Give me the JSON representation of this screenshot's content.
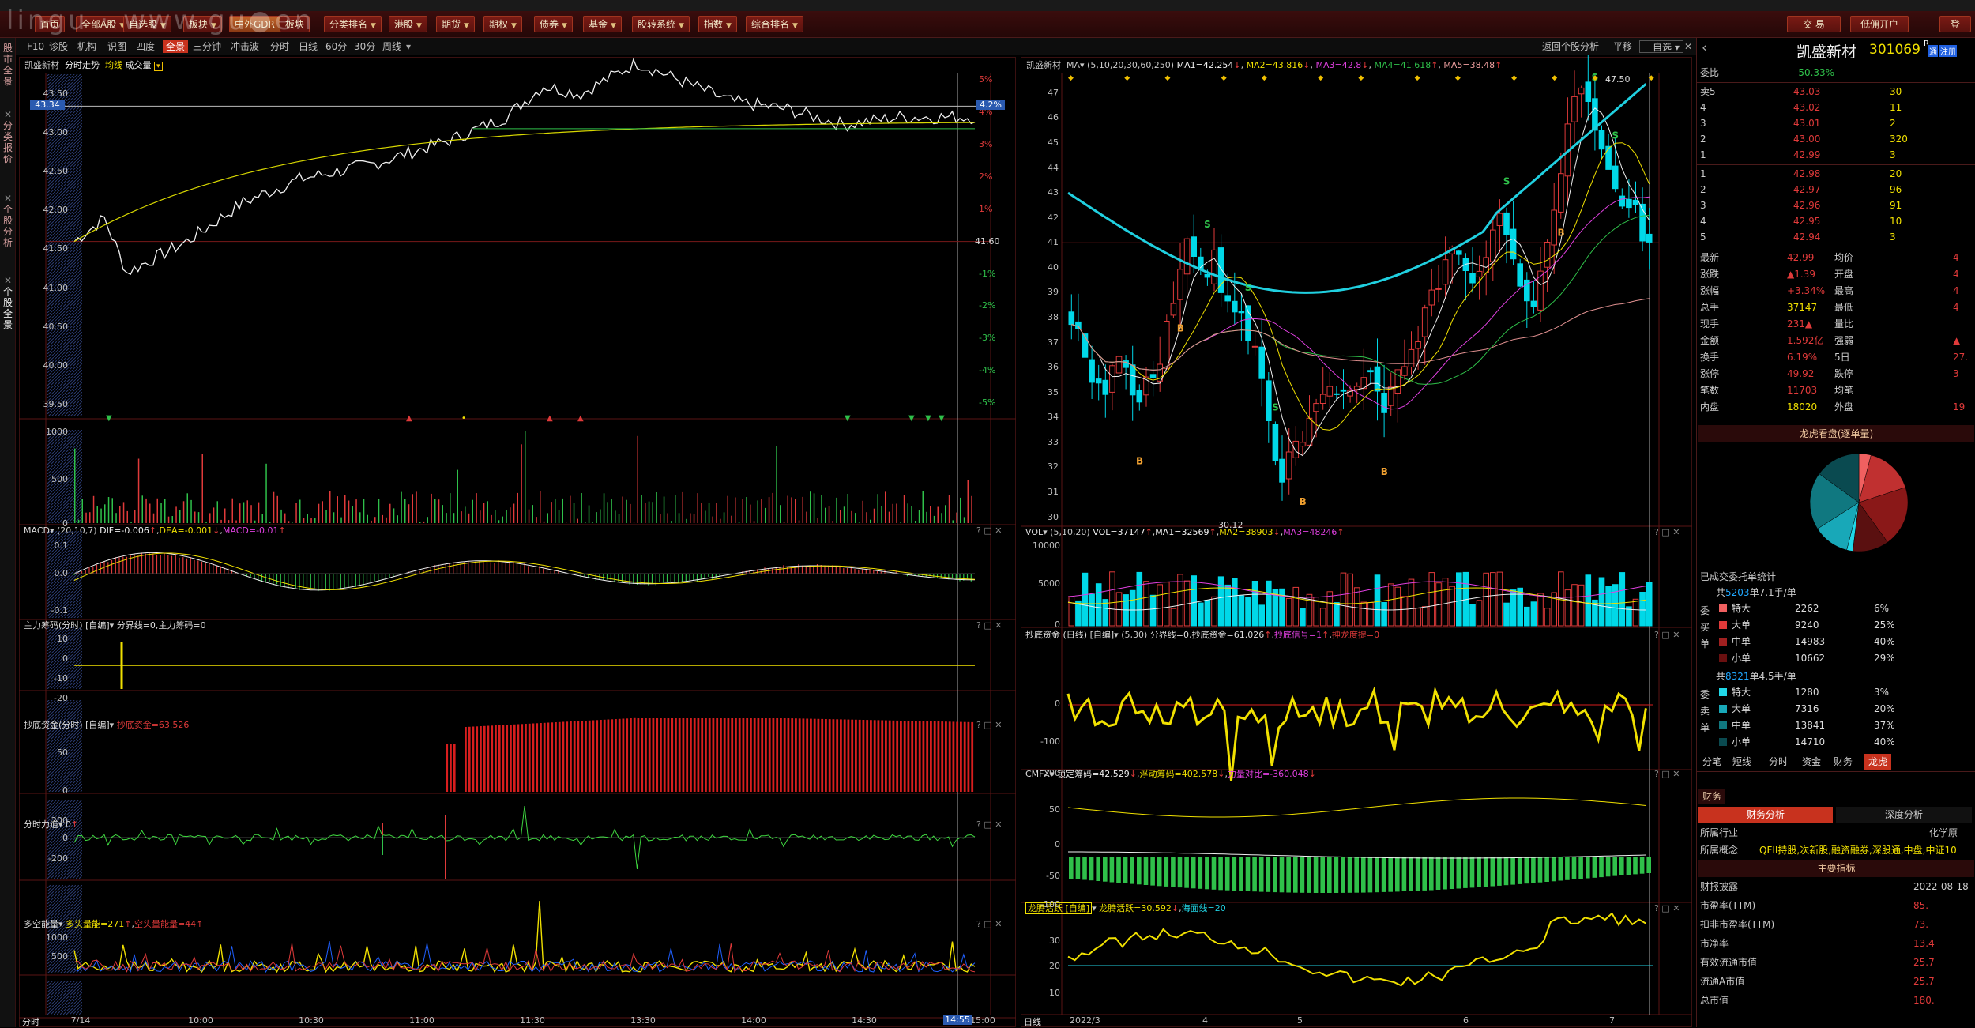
{
  "toolbar": {
    "buttons": [
      {
        "label": "首页",
        "dd": ""
      },
      {
        "label": "全部A股",
        "dd": "▼"
      },
      {
        "label": "自选股",
        "dd": "▼"
      },
      {
        "label": "板块",
        "dd": "▼"
      },
      {
        "label": "中外GDR",
        "dd": ""
      },
      {
        "label": "板块",
        "dd": ""
      },
      {
        "label": "分类排名",
        "dd": "▼"
      },
      {
        "label": "港股",
        "dd": "▼"
      },
      {
        "label": "期货",
        "dd": "▼"
      },
      {
        "label": "期权",
        "dd": "▼"
      },
      {
        "label": "债券",
        "dd": "▼"
      },
      {
        "label": "基金",
        "dd": "▼"
      },
      {
        "label": "股转系统",
        "dd": "▼"
      },
      {
        "label": "指数",
        "dd": "▼"
      },
      {
        "label": "综合排名",
        "dd": "▼"
      }
    ],
    "trade": "交 易",
    "open_account": "低佣开户",
    "more": "登"
  },
  "subbar": {
    "items": [
      "F10",
      "诊股",
      "机构",
      "识图",
      "四度",
      "全景",
      "三分钟",
      "冲击波"
    ],
    "selected": "全景",
    "periods": [
      "分时",
      "日线",
      "60分",
      "30分",
      "周线"
    ],
    "right_back": "返回个股分析",
    "right_flat": "平移",
    "right_pick": "一自选"
  },
  "sidetabs": [
    "股市全景",
    "分类报价",
    "个股分析",
    "个股全景"
  ],
  "watermark": "lingu · www.gu●en",
  "left": {
    "header": {
      "name": "凯盛新材",
      "chart": "分时走势",
      "avg": "均线",
      "vol": "成交量"
    },
    "price_axis": [
      "43.50",
      "43.00",
      "42.50",
      "42.00",
      "41.50",
      "41.00",
      "40.50",
      "40.00",
      "39.50"
    ],
    "price_flag": "43.34",
    "pct_flag": "4.2%",
    "pre_close_label": "41.60",
    "pct_axis_up": [
      "5%",
      "4%",
      "3%",
      "2%",
      "1%"
    ],
    "pct_axis_down": [
      "-1%",
      "-2%",
      "-3%",
      "-4%",
      "-5%"
    ],
    "vol_axis": [
      "1000",
      "500",
      "0"
    ],
    "macd": {
      "title": "MACD",
      "params": "(20,10,7)",
      "dif": "DIF=-0.006",
      "dea": "DEA=-0.001",
      "macd": "MACD=-0.01",
      "axis": [
        "0.1",
        "0.0",
        "-0.1"
      ]
    },
    "zlcm": {
      "title": "主力筹码(分时) [自编]",
      "text": "分界线=0,主力筹码=0",
      "axis": [
        "10",
        "0",
        "-10",
        "-20"
      ]
    },
    "cdzj": {
      "title": "抄底资金(分时) [自编]",
      "text": "抄底资金=63.526",
      "axis": [
        "50",
        "0"
      ]
    },
    "fsld": {
      "title": "分时力道",
      "text": "0",
      "axis": [
        "200",
        "0",
        "-200"
      ]
    },
    "dknl": {
      "title": "多空能量",
      "bull": "多头量能=271",
      "bear": "空头量能量=44",
      "axis": [
        "1000",
        "500"
      ]
    },
    "time_axis": [
      "7/14",
      "10:00",
      "10:30",
      "11:00",
      "11:30",
      "13:30",
      "14:00",
      "14:30",
      "15:00"
    ],
    "time_flag": "14:55",
    "bottom_tab": "分时"
  },
  "mid": {
    "header": {
      "name": "凯盛新材",
      "ma": "MA",
      "params": "(5,10,20,30,60,250)",
      "ma1": "MA1=42.254",
      "ma2": "MA2=43.816",
      "ma3": "MA3=42.8",
      "ma4": "MA4=41.618",
      "ma5": "MA5=38.48"
    },
    "price_axis": [
      "47",
      "46",
      "45",
      "44",
      "43",
      "42",
      "41",
      "40",
      "39",
      "38",
      "37",
      "36",
      "35",
      "34",
      "33",
      "32",
      "31",
      "30"
    ],
    "high_label": "47.50",
    "low_label": "30.12",
    "vol": {
      "title": "VOL",
      "params": "(5,10,20)",
      "vol": "VOL=37147",
      "ma1": "MA1=32569",
      "ma2": "MA2=38903",
      "ma3": "MA3=48246",
      "axis": [
        "10000",
        "5000",
        "0"
      ]
    },
    "cdzj": {
      "title": "抄底资金 (日线) [自编]",
      "params": "(5,30)",
      "text": "分界线=0,抄底资金=61.026",
      "signal": "抄底信号=1",
      "shen": "抻龙度提=0",
      "axis": [
        "0",
        "-100",
        "-200"
      ]
    },
    "cmfx": {
      "title": "CMFX",
      "lock": "锁定筹码=42.529",
      "float": "浮动筹码=402.578",
      "power": "力量对比=-360.048",
      "axis": [
        "50",
        "0",
        "-50",
        "-100"
      ]
    },
    "lthy": {
      "title": "龙腾活跃 [自编]",
      "text": "龙腾活跃=30.592",
      "sea": "海面线=20",
      "axis": [
        "30",
        "20",
        "10"
      ]
    },
    "date_axis": [
      "2022/3",
      "4",
      "5",
      "6",
      "7"
    ],
    "bottom_tab": "日线"
  },
  "right": {
    "name": "凯盛新材",
    "code": "301069",
    "badges": [
      "R",
      "通",
      "注册"
    ],
    "weibi_label": "委比",
    "weibi": "-50.33%",
    "weicha": "-",
    "asks": [
      [
        "卖5",
        "43.03",
        "30"
      ],
      [
        "4",
        "43.02",
        "11"
      ],
      [
        "3",
        "43.01",
        "2"
      ],
      [
        "2",
        "43.00",
        "320"
      ],
      [
        "1",
        "42.99",
        "3"
      ]
    ],
    "bids": [
      [
        "1",
        "42.98",
        "20"
      ],
      [
        "2",
        "42.97",
        "96"
      ],
      [
        "3",
        "42.96",
        "91"
      ],
      [
        "4",
        "42.95",
        "10"
      ],
      [
        "5",
        "42.94",
        "3"
      ]
    ],
    "stats": [
      [
        "最新",
        "42.99",
        "均价",
        "4"
      ],
      [
        "涨跌",
        "▲1.39",
        "开盘",
        "4"
      ],
      [
        "涨幅",
        "+3.34%",
        "最高",
        "4"
      ],
      [
        "总手",
        "37147",
        "最低",
        "4"
      ],
      [
        "现手",
        "231▲",
        "量比",
        ""
      ],
      [
        "金额",
        "1.592亿",
        "强弱",
        "▲"
      ],
      [
        "换手",
        "6.19%",
        "5日",
        "27."
      ],
      [
        "涨停",
        "49.92",
        "跌停",
        "3"
      ],
      [
        "笔数",
        "11703",
        "均笔",
        ""
      ],
      [
        "内盘",
        "18020",
        "外盘",
        "19"
      ]
    ],
    "pie_title": "龙虎看盘(逐单量)",
    "entrust_title": "已成交委托单统计",
    "buy_summary": {
      "pre": "共",
      "count": "5203",
      "post": "单7.1手/单"
    },
    "buy_rows": [
      [
        "特大",
        "2262",
        "6%"
      ],
      [
        "大单",
        "9240",
        "25%"
      ],
      [
        "中单",
        "14983",
        "40%"
      ],
      [
        "小单",
        "10662",
        "29%"
      ]
    ],
    "sell_summary": {
      "pre": "共",
      "count": "8321",
      "post": "单4.5手/单"
    },
    "sell_rows": [
      [
        "特大",
        "1280",
        "3%"
      ],
      [
        "大单",
        "7316",
        "20%"
      ],
      [
        "中单",
        "13841",
        "37%"
      ],
      [
        "小单",
        "14710",
        "40%"
      ]
    ],
    "side_buy": [
      "委",
      "买",
      "单"
    ],
    "side_sell": [
      "委",
      "卖",
      "单"
    ],
    "tabs": [
      "分笔",
      "短线",
      "分时",
      "资金",
      "财务",
      "龙虎"
    ],
    "tab_selected": "龙虎",
    "fin_tab": "财务",
    "fin_analysis": "财务分析",
    "deep_analysis": "深度分析",
    "industry_label": "所属行业",
    "industry": "化学原",
    "concept_label": "所属概念",
    "concept": "QFII持股,次新股,融资融券,深股通,中盘,中证10",
    "key_title": "主要指标",
    "fin_rows": [
      [
        "财报披露",
        "2022-08-18"
      ],
      [
        "市盈率(TTM)",
        "85."
      ],
      [
        "扣非市盈率(TTM)",
        "73."
      ],
      [
        "市净率",
        "13.4"
      ],
      [
        "有效流通市值",
        "25.7"
      ],
      [
        "流通A市值",
        "25.7"
      ],
      [
        "总市值",
        "180."
      ]
    ]
  },
  "colors": {
    "up": "#e03a3a",
    "down": "#00d8e8",
    "up_green": "#2fc04a",
    "yellow": "#f0e000",
    "panel_border": "#3a1010"
  }
}
